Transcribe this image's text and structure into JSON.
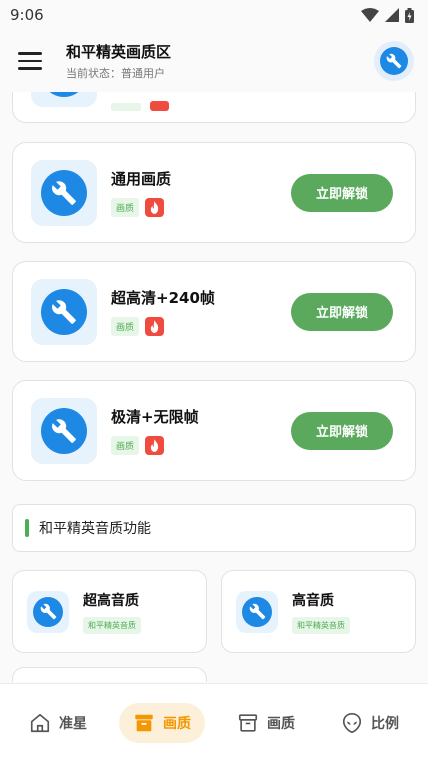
{
  "status_bar": {
    "time": "9:06"
  },
  "app_bar": {
    "title": "和平精英画质区",
    "subtitle": "当前状态：普通用户"
  },
  "unlock_cards": [
    {
      "title": "通用画质",
      "tag": "画质",
      "button": "立即解锁"
    },
    {
      "title": "超高清+240帧",
      "tag": "画质",
      "button": "立即解锁"
    },
    {
      "title": "极清+无限帧",
      "tag": "画质",
      "button": "立即解锁"
    }
  ],
  "section": {
    "title": "和平精英音质功能"
  },
  "audio_cards": [
    {
      "title": "超高音质",
      "tag": "和平精英音质"
    },
    {
      "title": "高音质",
      "tag": "和平精英音质"
    }
  ],
  "bottom_nav": [
    {
      "label": "准星",
      "icon": "home-icon",
      "active": false
    },
    {
      "label": "画质",
      "icon": "box-icon",
      "active": true
    },
    {
      "label": "画质",
      "icon": "archive-icon",
      "active": false
    },
    {
      "label": "比例",
      "icon": "alien-icon",
      "active": false
    }
  ],
  "colors": {
    "accent_blue": "#1e88e5",
    "green": "#5aa95d",
    "fire_red": "#ef4b3f",
    "active_orange": "#f39800"
  }
}
